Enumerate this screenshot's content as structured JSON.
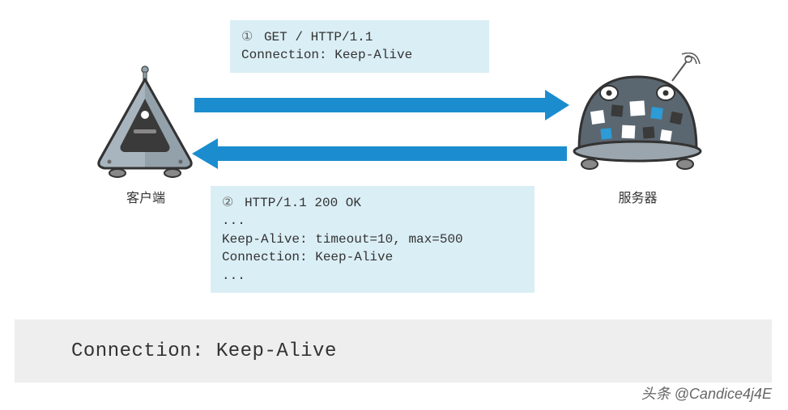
{
  "diagram": {
    "client_label": "客户端",
    "server_label": "服务器",
    "request_marker": "①",
    "request_lines": "GET / HTTP/1.1\nConnection: Keep-Alive",
    "response_marker": "②",
    "response_lines": "HTTP/1.1 200 OK\n...\nKeep-Alive: timeout=10, max=500\nConnection: Keep-Alive\n..."
  },
  "bottom": {
    "code": "Connection: Keep-Alive"
  },
  "watermark": "头条 @Candice4j4E",
  "colors": {
    "arrow": "#1b8dcf",
    "box_bg": "#daeef5",
    "bottom_bg": "#eeeeee"
  }
}
